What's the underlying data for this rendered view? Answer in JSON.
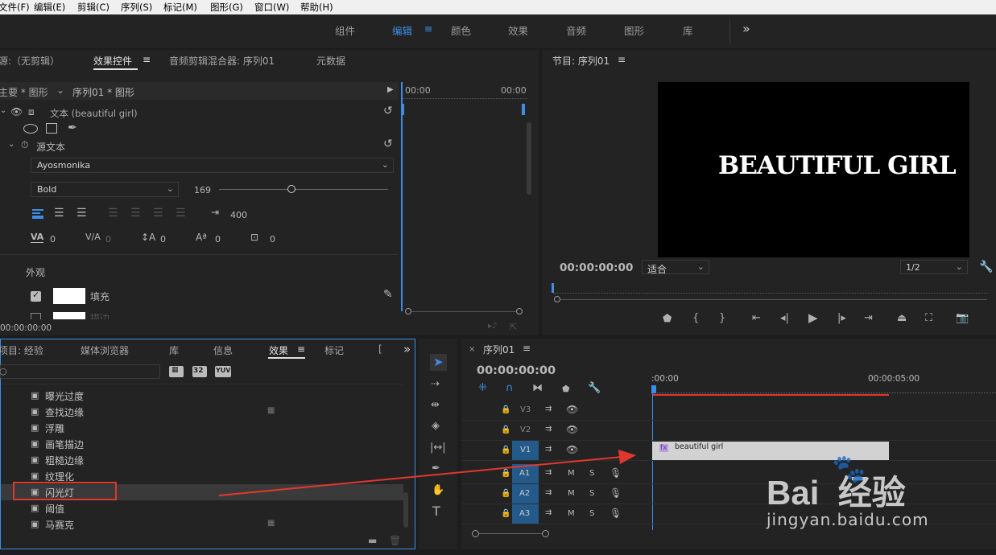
{
  "menu": [
    "文件(F)",
    "编辑(E)",
    "剪辑(C)",
    "序列(S)",
    "标记(M)",
    "图形(G)",
    "窗口(W)",
    "帮助(H)"
  ],
  "workspaces": {
    "items": [
      "组件",
      "编辑",
      "颜色",
      "效果",
      "音频",
      "图形",
      "库"
    ],
    "active": "编辑",
    "more": "»"
  },
  "effect_panel": {
    "tabs": [
      "源:（无剪辑）",
      "效果控件",
      "音频剪辑混合器: 序列01",
      "元数据"
    ],
    "crumb": "主要 * 图形",
    "crumb_active": "序列01 * 图形",
    "tl_start": "00:00",
    "tl_end": "00:00",
    "text_layer": "文本 (beautiful  girl)",
    "source_text": "源文本",
    "font": "Ayosmonika",
    "style": "Bold",
    "size": "169",
    "tracking_val": "400",
    "val1": "0",
    "val2": "0",
    "val3": "0",
    "val4": "0",
    "val5": "0",
    "appearance": "外观",
    "fill": "填充",
    "stroke": "描边",
    "timecode": "00:00:00:00"
  },
  "program": {
    "title": "节目: 序列01",
    "preview_text": "BEAUTIFUL  GIRL",
    "timecode": "00:00:00:00",
    "fit": "适合",
    "quality": "1/2"
  },
  "project": {
    "tabs": [
      "项目: 经验",
      "媒体浏览器",
      "库",
      "信息",
      "效果",
      "标记"
    ],
    "bins": [
      "32",
      "YUV"
    ],
    "items": [
      "曝光过度",
      "查找边缘",
      "浮雕",
      "画笔描边",
      "粗糙边缘",
      "纹理化",
      "闪光灯",
      "阈值",
      "马赛克"
    ],
    "highlighted": "闪光灯"
  },
  "timeline": {
    "tab": "序列01",
    "timecode": "00:00:00:00",
    "ruler": [
      ":00:00",
      "00:00:05:00"
    ],
    "tracks_video": [
      "V3",
      "V2",
      "V1"
    ],
    "tracks_audio": [
      "A1",
      "A2",
      "A3"
    ],
    "m": "M",
    "s": "S",
    "clip": "beautiful  girl",
    "fx": "fx"
  },
  "watermark": {
    "brand": "Bai  经验",
    "url": "jingyan.baidu.com"
  }
}
